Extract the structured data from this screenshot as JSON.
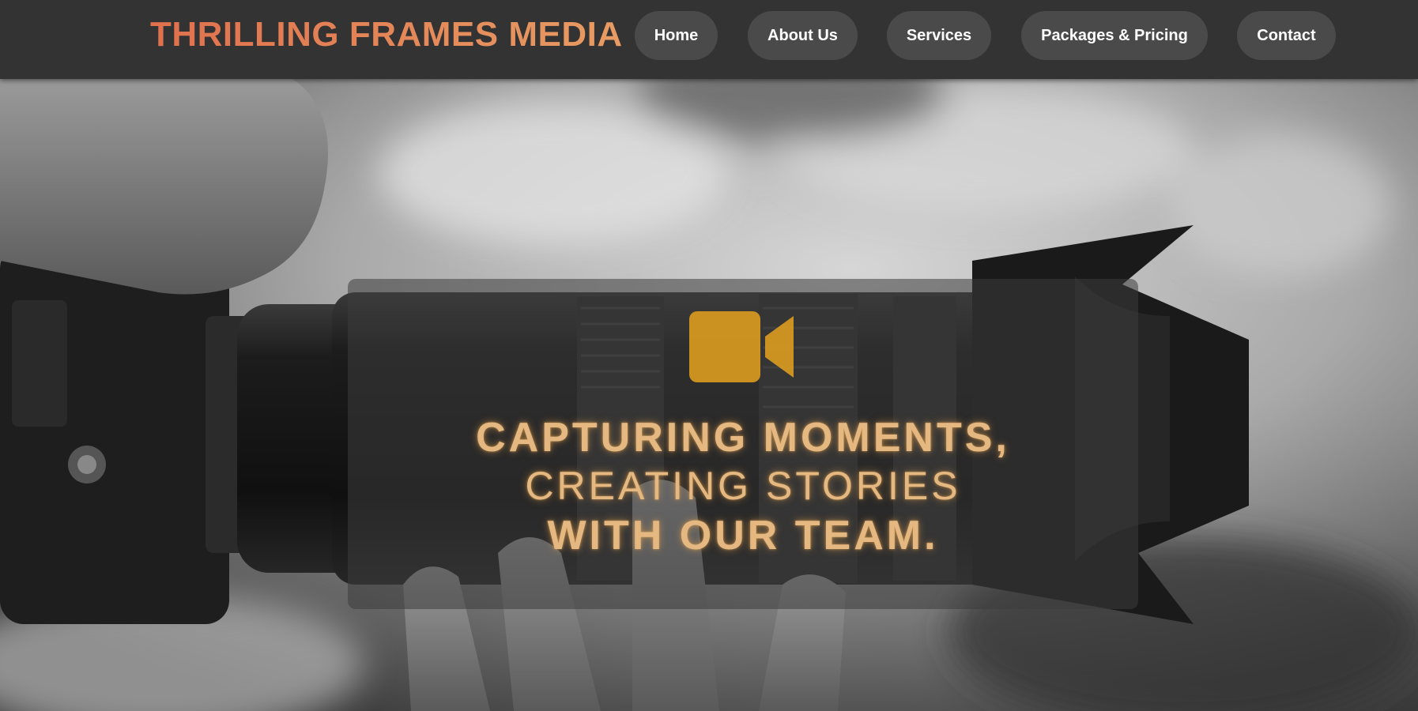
{
  "header": {
    "brand": "THRILLING FRAMES MEDIA",
    "nav": [
      {
        "label": "Home"
      },
      {
        "label": "About Us"
      },
      {
        "label": "Services"
      },
      {
        "label": "Packages & Pricing"
      },
      {
        "label": "Contact"
      }
    ]
  },
  "hero": {
    "icon": "video-camera-icon",
    "tagline_line1": "CAPTURING MOMENTS,",
    "tagline_line2": "CREATING STORIES",
    "tagline_line3": "WITH OUR TEAM."
  },
  "colors": {
    "header_bg": "#333333",
    "brand_gradient_start": "#e0704d",
    "brand_gradient_end": "#e89c63",
    "nav_button_bg": "#4a4a4a",
    "icon_color": "#d99a1f",
    "tagline_color": "#e4b880"
  }
}
